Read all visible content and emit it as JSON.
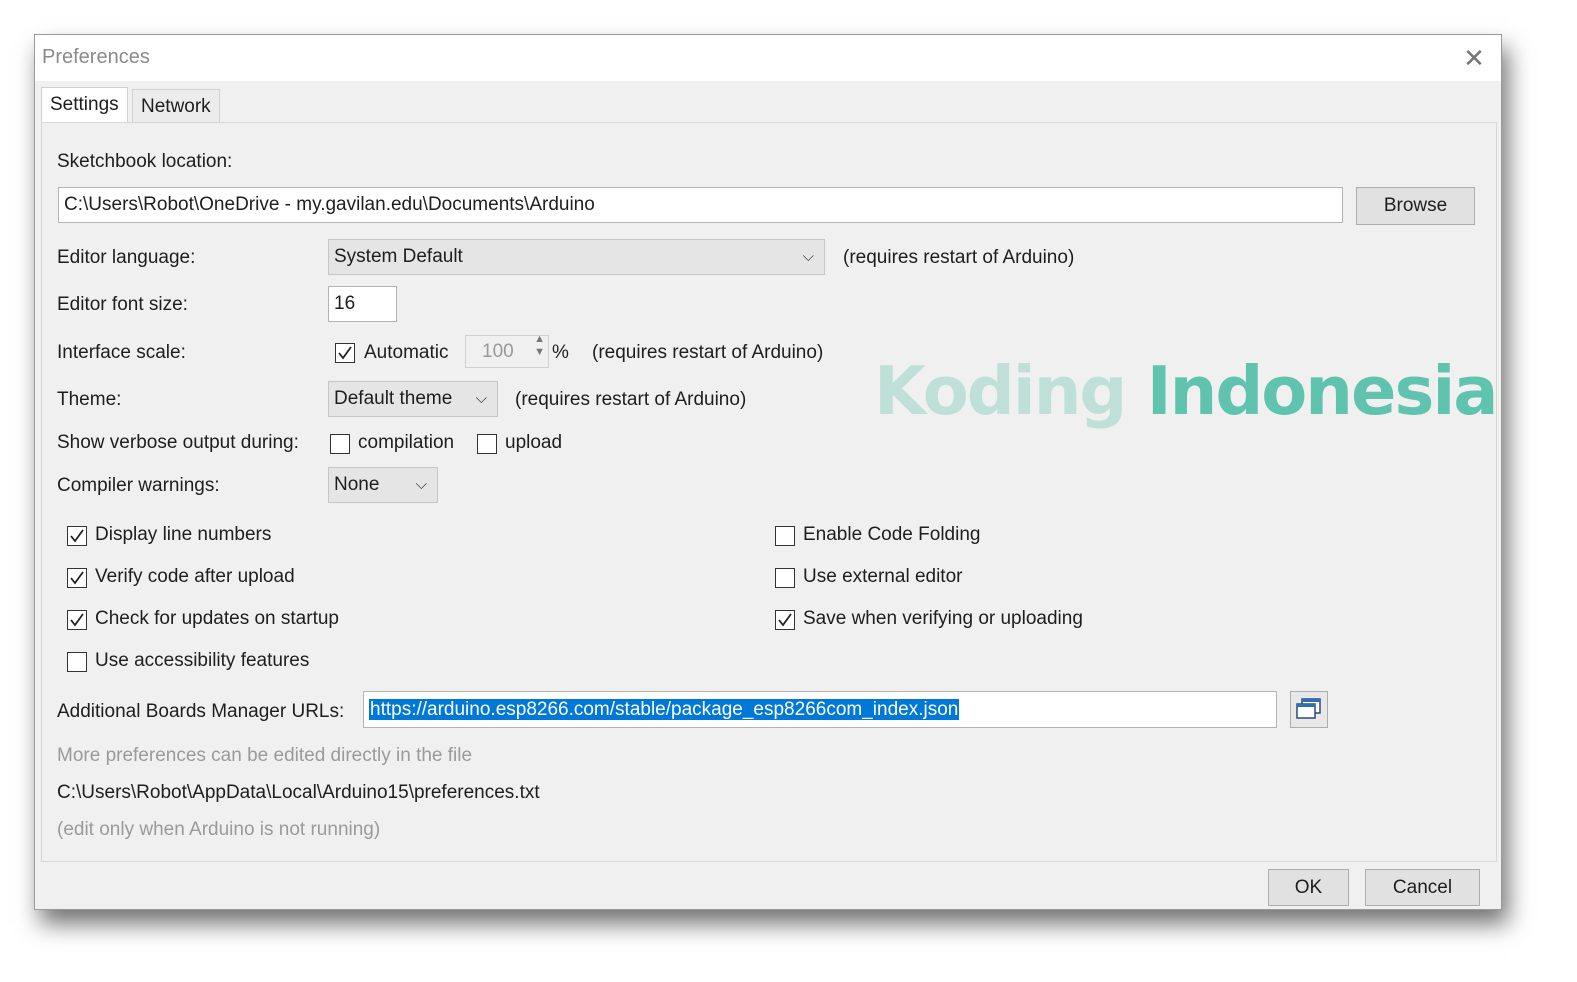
{
  "window": {
    "title": "Preferences",
    "close_icon": "close-icon"
  },
  "tabs": [
    {
      "label": "Settings",
      "active": true
    },
    {
      "label": "Network",
      "active": false
    }
  ],
  "settings": {
    "sketchbook_label": "Sketchbook location:",
    "sketchbook_path": "C:\\Users\\Robot\\OneDrive - my.gavilan.edu\\Documents\\Arduino",
    "browse_label": "Browse",
    "editor_language_label": "Editor language:",
    "editor_language_value": "System Default",
    "restart_note": "(requires restart of Arduino)",
    "font_size_label": "Editor font size:",
    "font_size_value": "16",
    "interface_scale_label": "Interface scale:",
    "automatic_label": "Automatic",
    "automatic_checked": true,
    "scale_value": "100",
    "percent": "%",
    "theme_label": "Theme:",
    "theme_value": "Default theme",
    "verbose_label": "Show verbose output during:",
    "compilation_label": "compilation",
    "upload_label": "upload",
    "compiler_warnings_label": "Compiler warnings:",
    "compiler_warnings_value": "None",
    "left_options": [
      {
        "label": "Display line numbers",
        "checked": true
      },
      {
        "label": "Verify code after upload",
        "checked": true
      },
      {
        "label": "Check for updates on startup",
        "checked": true
      },
      {
        "label": "Use accessibility features",
        "checked": false
      }
    ],
    "right_options": [
      {
        "label": "Enable Code Folding",
        "checked": false
      },
      {
        "label": "Use external editor",
        "checked": false
      },
      {
        "label": "Save when verifying or uploading",
        "checked": true
      }
    ],
    "boards_urls_label": "Additional Boards Manager URLs:",
    "boards_urls_value": "https://arduino.esp8266.com/stable/package_esp8266com_index.json",
    "boards_urls_icon": "window-stack-icon",
    "more_prefs_note": "More preferences can be edited directly in the file",
    "prefs_file_path": "C:\\Users\\Robot\\AppData\\Local\\Arduino15\\preferences.txt",
    "edit_note": "(edit only when Arduino is not running)"
  },
  "footer": {
    "ok_label": "OK",
    "cancel_label": "Cancel"
  },
  "watermark": {
    "word1": "Koding",
    "word2": "Indonesia",
    "color1": "#bfe0d8",
    "color2": "#5fc3ad"
  },
  "colors": {
    "selection": "#0078d7",
    "dialog_bg": "#f0f0f0"
  }
}
